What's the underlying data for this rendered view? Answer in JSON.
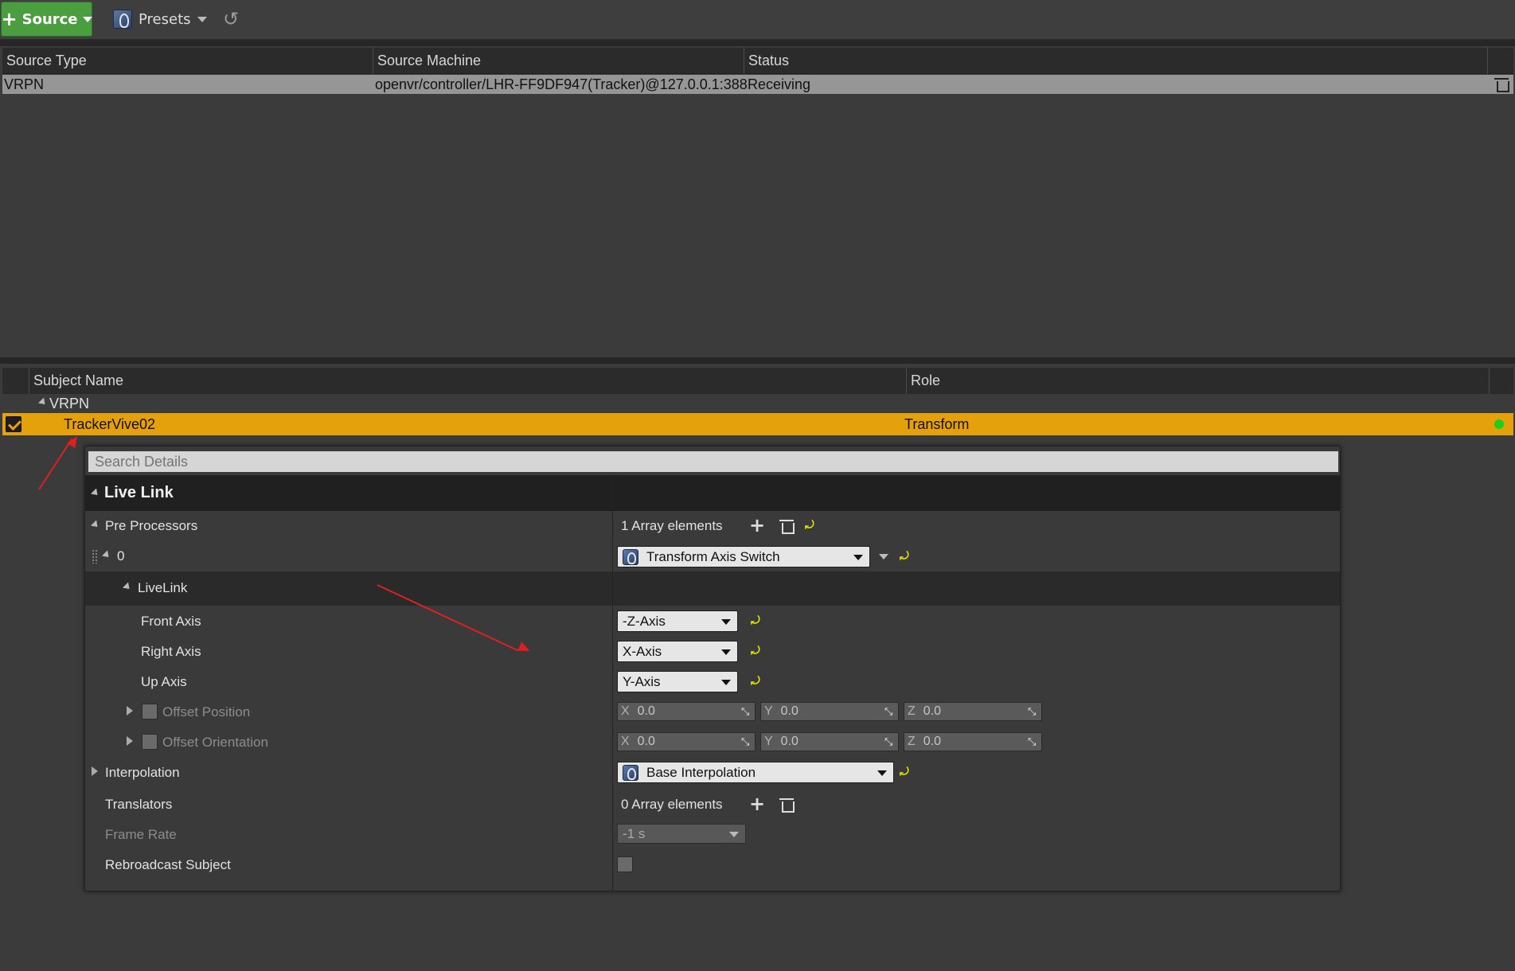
{
  "toolbar": {
    "source_label": "Source",
    "presets_label": "Presets"
  },
  "sources": {
    "columns": [
      "Source Type",
      "Source Machine",
      "Status"
    ],
    "rows": [
      {
        "type": "VRPN",
        "machine": "openvr/controller/LHR-FF9DF947(Tracker)@127.0.0.1:388",
        "status": "Receiving"
      }
    ]
  },
  "subjects": {
    "columns": [
      "Subject Name",
      "Role"
    ],
    "group": "VRPN",
    "rows": [
      {
        "name": "TrackerVive02",
        "role": "Transform",
        "enabled": true,
        "status_color": "#19d11a"
      }
    ]
  },
  "details": {
    "search_placeholder": "Search Details",
    "category": "Live Link",
    "pre_processors": {
      "label": "Pre Processors",
      "count_text": "1 Array elements",
      "element_index": "0",
      "element_value": "Transform Axis Switch",
      "sub_category": "LiveLink",
      "front_axis": {
        "label": "Front Axis",
        "value": "-Z-Axis"
      },
      "right_axis": {
        "label": "Right Axis",
        "value": "X-Axis"
      },
      "up_axis": {
        "label": "Up Axis",
        "value": "Y-Axis"
      },
      "offset_position": {
        "label": "Offset Position",
        "x": "0.0",
        "y": "0.0",
        "z": "0.0"
      },
      "offset_orientation": {
        "label": "Offset Orientation",
        "x": "0.0",
        "y": "0.0",
        "z": "0.0"
      }
    },
    "interpolation": {
      "label": "Interpolation",
      "value": "Base Interpolation"
    },
    "translators": {
      "label": "Translators",
      "count_text": "0 Array elements"
    },
    "frame_rate": {
      "label": "Frame Rate",
      "value": "-1 s"
    },
    "rebroadcast": {
      "label": "Rebroadcast Subject",
      "checked": false
    },
    "axis_letters": {
      "x": "X",
      "y": "Y",
      "z": "Z"
    }
  },
  "colors": {
    "accent_source": "#4a9e3f",
    "selection": "#e5a10b",
    "annotation_arrow": "#e02020"
  }
}
